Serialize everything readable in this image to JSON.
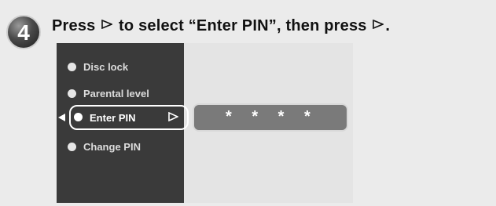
{
  "step": {
    "number": "4"
  },
  "instruction": {
    "part1": "Press",
    "part2": "to select “Enter PIN”, then press",
    "part3": "."
  },
  "menu": {
    "items": [
      {
        "label": "Disc lock"
      },
      {
        "label": "Parental level"
      },
      {
        "label": "Enter PIN"
      },
      {
        "label": "Change PIN"
      }
    ],
    "selected_index": 2
  },
  "pin": {
    "value": "* * * *"
  },
  "colors": {
    "menu_background": "#3a3a3a",
    "content_background": "#e4e4e4",
    "pin_field": "#7a7a7a",
    "panel": "#ebebeb"
  }
}
